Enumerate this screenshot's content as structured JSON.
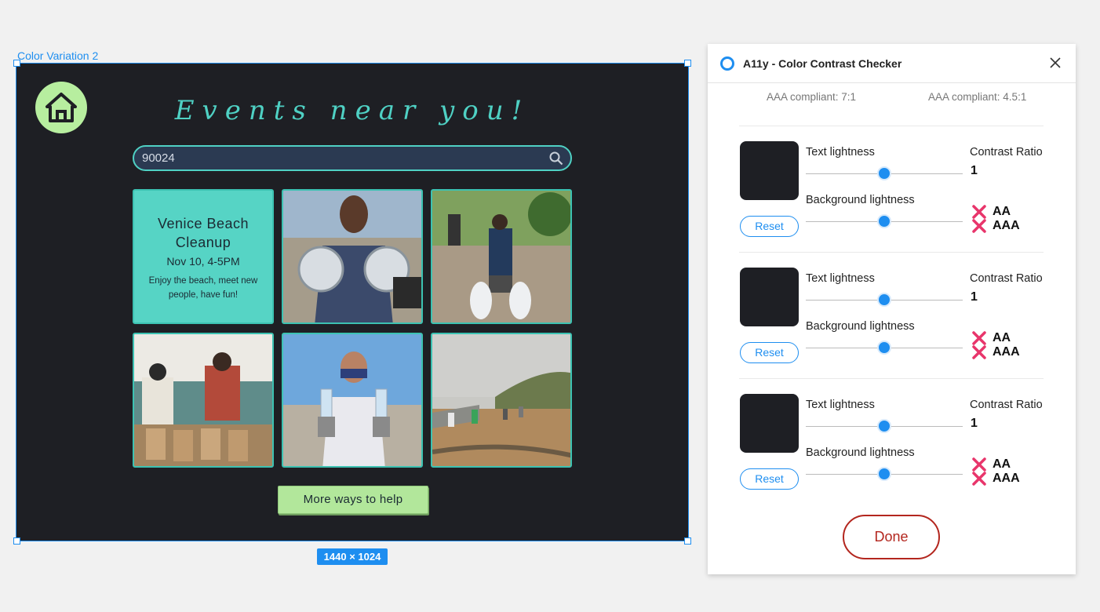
{
  "canvas": {
    "frame_label": "Color Variation 2",
    "size_badge": "1440 × 1024"
  },
  "design": {
    "headline": "Events near you!",
    "search_value": "90024",
    "event_card": {
      "title": "Venice Beach Cleanup",
      "date": "Nov 10, 4-5PM",
      "description": "Enjoy the beach, meet new people, have fun!"
    },
    "photos": [
      "photo-person-holding-plastic-lids",
      "photo-beach-cleanup-walkers",
      "photo-volunteers-packing-bags",
      "photo-person-holding-bottles",
      "photo-beach-cleanup-shoreline"
    ],
    "more_button": "More ways to help",
    "colors": {
      "background": "#1e1f24",
      "accent_teal": "#4fd1c4",
      "home_green": "#b7ee9f",
      "button_green": "#b2e79b"
    }
  },
  "plugin": {
    "title": "A11y - Color Contrast Checker",
    "compliance_left": "AAA compliant: 7:1",
    "compliance_right": "AAA compliant: 4.5:1",
    "blocks": [
      {
        "text_lightness_label": "Text lightness",
        "bg_lightness_label": "Background lightness",
        "text_lightness_value": 0.5,
        "bg_lightness_value": 0.5,
        "contrast_ratio_label": "Contrast Ratio",
        "contrast_ratio_value": "1",
        "aa_label": "AA",
        "aaa_label": "AAA",
        "reset_label": "Reset"
      },
      {
        "text_lightness_label": "Text lightness",
        "bg_lightness_label": "Background lightness",
        "text_lightness_value": 0.5,
        "bg_lightness_value": 0.5,
        "contrast_ratio_label": "Contrast Ratio",
        "contrast_ratio_value": "1",
        "aa_label": "AA",
        "aaa_label": "AAA",
        "reset_label": "Reset"
      },
      {
        "text_lightness_label": "Text lightness",
        "bg_lightness_label": "Background lightness",
        "text_lightness_value": 0.5,
        "bg_lightness_value": 0.5,
        "contrast_ratio_label": "Contrast Ratio",
        "contrast_ratio_value": "1",
        "aa_label": "AA",
        "aaa_label": "AAA",
        "reset_label": "Reset"
      }
    ],
    "done_label": "Done",
    "colors": {
      "accent_blue": "#1e8ef0",
      "fail_pink": "#e8356b",
      "done_red": "#b3261e"
    }
  }
}
